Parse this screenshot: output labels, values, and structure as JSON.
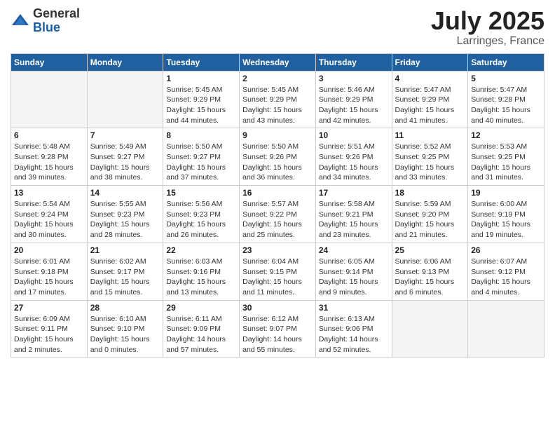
{
  "logo": {
    "general": "General",
    "blue": "Blue"
  },
  "title": {
    "month_year": "July 2025",
    "location": "Larringes, France"
  },
  "weekdays": [
    "Sunday",
    "Monday",
    "Tuesday",
    "Wednesday",
    "Thursday",
    "Friday",
    "Saturday"
  ],
  "weeks": [
    [
      {
        "day": "",
        "info": ""
      },
      {
        "day": "",
        "info": ""
      },
      {
        "day": "1",
        "info": "Sunrise: 5:45 AM\nSunset: 9:29 PM\nDaylight: 15 hours\nand 44 minutes."
      },
      {
        "day": "2",
        "info": "Sunrise: 5:45 AM\nSunset: 9:29 PM\nDaylight: 15 hours\nand 43 minutes."
      },
      {
        "day": "3",
        "info": "Sunrise: 5:46 AM\nSunset: 9:29 PM\nDaylight: 15 hours\nand 42 minutes."
      },
      {
        "day": "4",
        "info": "Sunrise: 5:47 AM\nSunset: 9:29 PM\nDaylight: 15 hours\nand 41 minutes."
      },
      {
        "day": "5",
        "info": "Sunrise: 5:47 AM\nSunset: 9:28 PM\nDaylight: 15 hours\nand 40 minutes."
      }
    ],
    [
      {
        "day": "6",
        "info": "Sunrise: 5:48 AM\nSunset: 9:28 PM\nDaylight: 15 hours\nand 39 minutes."
      },
      {
        "day": "7",
        "info": "Sunrise: 5:49 AM\nSunset: 9:27 PM\nDaylight: 15 hours\nand 38 minutes."
      },
      {
        "day": "8",
        "info": "Sunrise: 5:50 AM\nSunset: 9:27 PM\nDaylight: 15 hours\nand 37 minutes."
      },
      {
        "day": "9",
        "info": "Sunrise: 5:50 AM\nSunset: 9:26 PM\nDaylight: 15 hours\nand 36 minutes."
      },
      {
        "day": "10",
        "info": "Sunrise: 5:51 AM\nSunset: 9:26 PM\nDaylight: 15 hours\nand 34 minutes."
      },
      {
        "day": "11",
        "info": "Sunrise: 5:52 AM\nSunset: 9:25 PM\nDaylight: 15 hours\nand 33 minutes."
      },
      {
        "day": "12",
        "info": "Sunrise: 5:53 AM\nSunset: 9:25 PM\nDaylight: 15 hours\nand 31 minutes."
      }
    ],
    [
      {
        "day": "13",
        "info": "Sunrise: 5:54 AM\nSunset: 9:24 PM\nDaylight: 15 hours\nand 30 minutes."
      },
      {
        "day": "14",
        "info": "Sunrise: 5:55 AM\nSunset: 9:23 PM\nDaylight: 15 hours\nand 28 minutes."
      },
      {
        "day": "15",
        "info": "Sunrise: 5:56 AM\nSunset: 9:23 PM\nDaylight: 15 hours\nand 26 minutes."
      },
      {
        "day": "16",
        "info": "Sunrise: 5:57 AM\nSunset: 9:22 PM\nDaylight: 15 hours\nand 25 minutes."
      },
      {
        "day": "17",
        "info": "Sunrise: 5:58 AM\nSunset: 9:21 PM\nDaylight: 15 hours\nand 23 minutes."
      },
      {
        "day": "18",
        "info": "Sunrise: 5:59 AM\nSunset: 9:20 PM\nDaylight: 15 hours\nand 21 minutes."
      },
      {
        "day": "19",
        "info": "Sunrise: 6:00 AM\nSunset: 9:19 PM\nDaylight: 15 hours\nand 19 minutes."
      }
    ],
    [
      {
        "day": "20",
        "info": "Sunrise: 6:01 AM\nSunset: 9:18 PM\nDaylight: 15 hours\nand 17 minutes."
      },
      {
        "day": "21",
        "info": "Sunrise: 6:02 AM\nSunset: 9:17 PM\nDaylight: 15 hours\nand 15 minutes."
      },
      {
        "day": "22",
        "info": "Sunrise: 6:03 AM\nSunset: 9:16 PM\nDaylight: 15 hours\nand 13 minutes."
      },
      {
        "day": "23",
        "info": "Sunrise: 6:04 AM\nSunset: 9:15 PM\nDaylight: 15 hours\nand 11 minutes."
      },
      {
        "day": "24",
        "info": "Sunrise: 6:05 AM\nSunset: 9:14 PM\nDaylight: 15 hours\nand 9 minutes."
      },
      {
        "day": "25",
        "info": "Sunrise: 6:06 AM\nSunset: 9:13 PM\nDaylight: 15 hours\nand 6 minutes."
      },
      {
        "day": "26",
        "info": "Sunrise: 6:07 AM\nSunset: 9:12 PM\nDaylight: 15 hours\nand 4 minutes."
      }
    ],
    [
      {
        "day": "27",
        "info": "Sunrise: 6:09 AM\nSunset: 9:11 PM\nDaylight: 15 hours\nand 2 minutes."
      },
      {
        "day": "28",
        "info": "Sunrise: 6:10 AM\nSunset: 9:10 PM\nDaylight: 15 hours\nand 0 minutes."
      },
      {
        "day": "29",
        "info": "Sunrise: 6:11 AM\nSunset: 9:09 PM\nDaylight: 14 hours\nand 57 minutes."
      },
      {
        "day": "30",
        "info": "Sunrise: 6:12 AM\nSunset: 9:07 PM\nDaylight: 14 hours\nand 55 minutes."
      },
      {
        "day": "31",
        "info": "Sunrise: 6:13 AM\nSunset: 9:06 PM\nDaylight: 14 hours\nand 52 minutes."
      },
      {
        "day": "",
        "info": ""
      },
      {
        "day": "",
        "info": ""
      }
    ]
  ]
}
